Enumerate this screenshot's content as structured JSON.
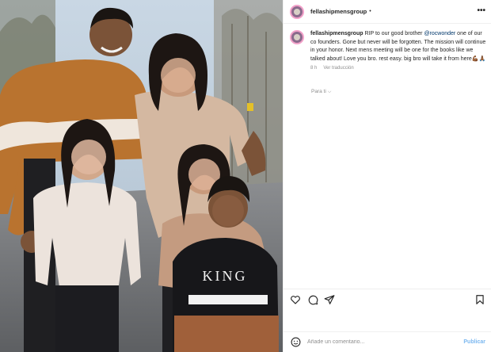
{
  "post": {
    "username": "fellashipmensgroup",
    "separator": "•",
    "more": "•••"
  },
  "caption": {
    "username": "fellashipmensgroup",
    "text_before": " RIP to our good brother ",
    "mention": "@rocwonder",
    "text_after": " one of our co founders. Gone but never will be forgotten. The mission will continue in your honor. Next mens meeting will be one for the books like we talked about! Love you bro. rest easy. big bro will take it from here💪🏾🙏🏾",
    "time": "8 h",
    "translate": "Ver traducción"
  },
  "for_you": {
    "label": "Para ti",
    "chevron": "⌵"
  },
  "shirt_text": "KING",
  "comment_box": {
    "placeholder": "Añade un comentario...",
    "publish": "Publicar"
  },
  "colors": {
    "link": "#00376b",
    "publish": "#7cb8f0",
    "secondary_text": "#8e8e8e"
  }
}
